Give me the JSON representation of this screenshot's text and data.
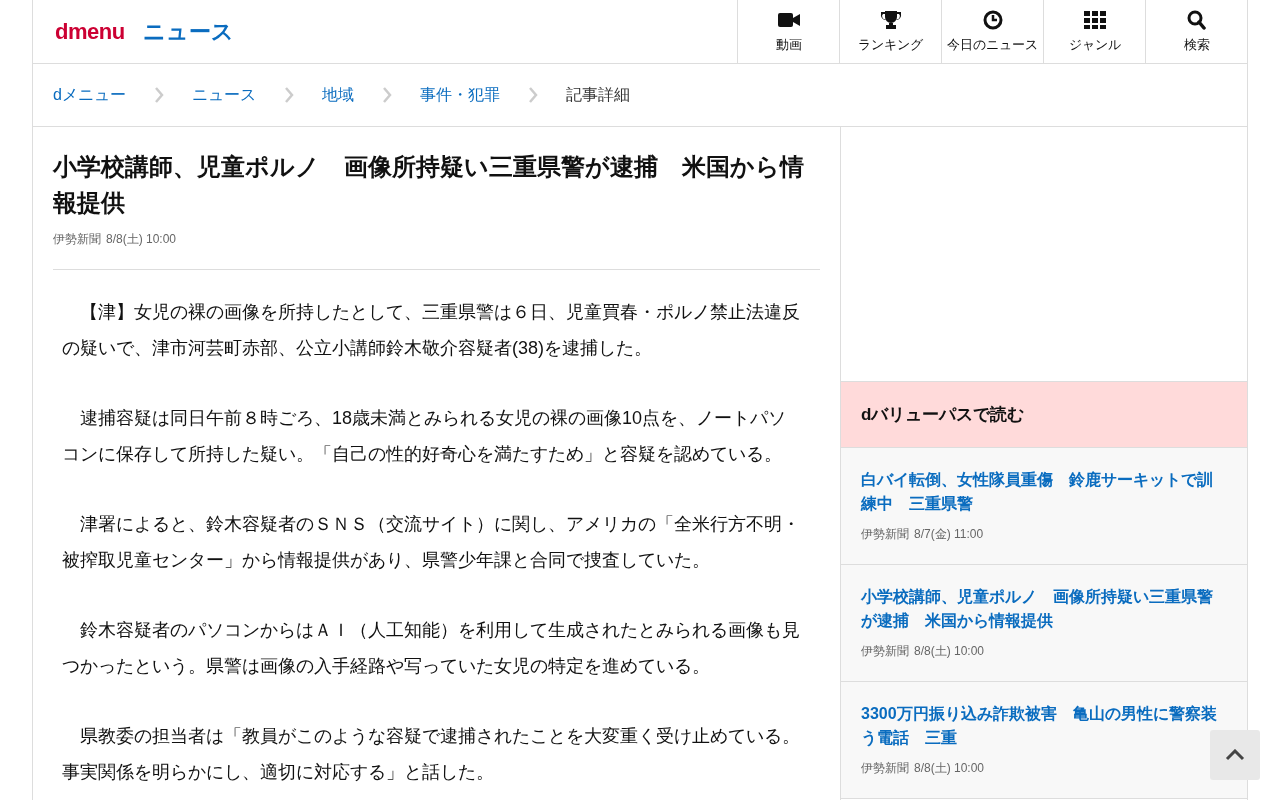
{
  "header": {
    "logo": "dmenu",
    "section": "ニュース",
    "nav": [
      {
        "kind": "video",
        "label": "動画"
      },
      {
        "kind": "trophy",
        "label": "ランキング"
      },
      {
        "kind": "clock",
        "label": "今日のニュース"
      },
      {
        "kind": "grid",
        "label": "ジャンル"
      },
      {
        "kind": "search",
        "label": "検索"
      }
    ]
  },
  "breadcrumb": [
    {
      "label": "dメニュー",
      "link": true
    },
    {
      "label": "ニュース",
      "link": true
    },
    {
      "label": "地域",
      "link": true
    },
    {
      "label": "事件・犯罪",
      "link": true
    },
    {
      "label": "記事詳細",
      "link": false
    }
  ],
  "article": {
    "title": "小学校講師、児童ポルノ　画像所持疑い三重県警が逮捕　米国から情報提供",
    "source": "伊勢新聞",
    "time": "8/8(土) 10:00",
    "paragraphs": [
      "　【津】女児の裸の画像を所持したとして、三重県警は６日、児童買春・ポルノ禁止法違反の疑いで、津市河芸町赤部、公立小講師鈴木敬介容疑者(38)を逮捕した。",
      "　逮捕容疑は同日午前８時ごろ、18歳未満とみられる女児の裸の画像10点を、ノートパソコンに保存して所持した疑い。「自己の性的好奇心を満たすため」と容疑を認めている。",
      "　津署によると、鈴木容疑者のＳＮＳ（交流サイト）に関し、アメリカの「全米行方不明・被搾取児童センター」から情報提供があり、県警少年課と合同で捜査していた。",
      "　鈴木容疑者のパソコンからはＡＩ（人工知能）を利用して生成されたとみられる画像も見つかったという。県警は画像の入手経路や写っていた女児の特定を進めている。",
      "　県教委の担当者は「教員がこのような容疑で逮捕されたことを大変重く受け止めている。事実関係を明らかにし、適切に対応する」と話した。"
    ]
  },
  "sidebar": {
    "heading": "dバリューパスで読む",
    "items": [
      {
        "title": "白バイ転倒、女性隊員重傷　鈴鹿サーキットで訓練中　三重県警",
        "source": "伊勢新聞",
        "time": "8/7(金) 11:00"
      },
      {
        "title": "小学校講師、児童ポルノ　画像所持疑い三重県警が逮捕　米国から情報提供",
        "source": "伊勢新聞",
        "time": "8/8(土) 10:00"
      },
      {
        "title": "3300万円振り込み詐欺被害　亀山の男性に警察装う電話　三重",
        "source": "伊勢新聞",
        "time": "8/8(土) 10:00"
      }
    ]
  }
}
